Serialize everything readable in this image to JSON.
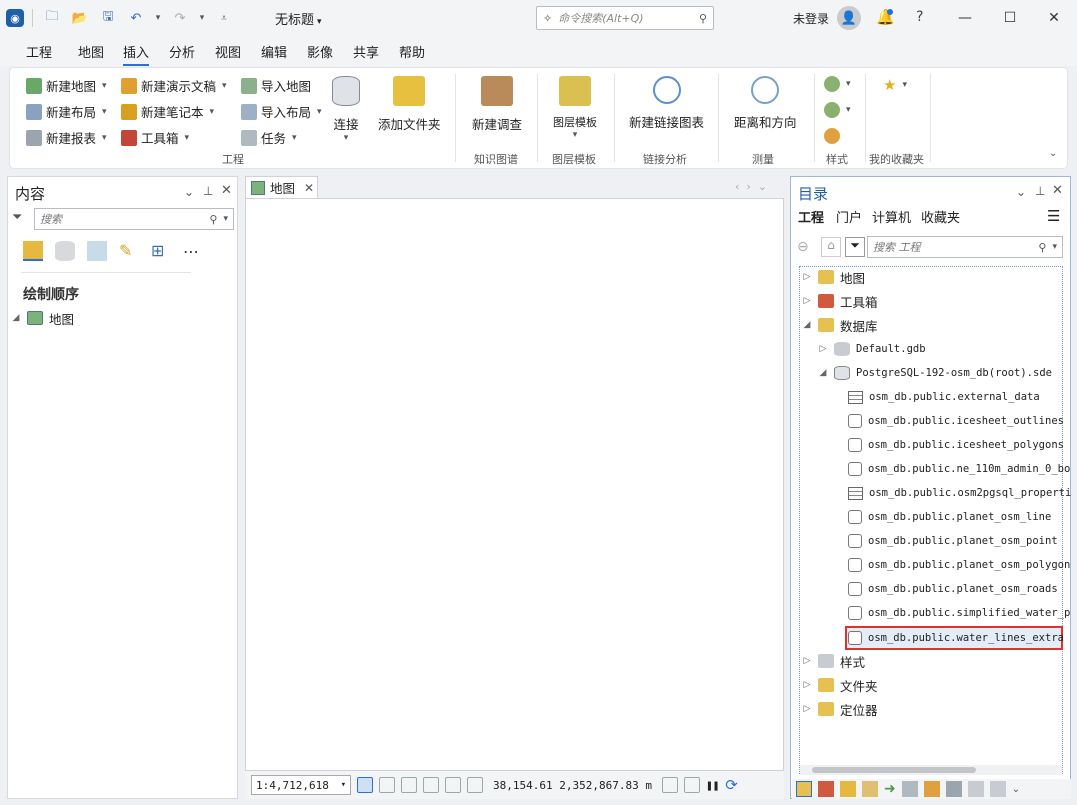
{
  "titlebar": {
    "doc_title": "无标题",
    "command_search_placeholder": "命令搜索(Alt+Q)",
    "login_label": "未登录",
    "help_label": "?",
    "minimize": "—",
    "maximize": "☐",
    "close": "✕"
  },
  "menu": {
    "tabs": [
      "工程",
      "地图",
      "插入",
      "分析",
      "视图",
      "编辑",
      "影像",
      "共享",
      "帮助"
    ],
    "active": "插入"
  },
  "ribbon": {
    "new_map": "新建地图",
    "new_presentation": "新建演示文稿",
    "import_map": "导入地图",
    "new_layout": "新建布局",
    "new_notebook": "新建笔记本",
    "import_layout": "导入布局",
    "new_report": "新建报表",
    "toolbox": "工具箱",
    "task": "任务",
    "connect": "连接",
    "add_folder": "添加文件夹",
    "group_project": "工程",
    "new_survey": "新建调查",
    "group_knowledge": "知识图谱",
    "layer_template": "图层模板",
    "group_layer_template": "图层模板",
    "new_link_chart": "新建链接图表",
    "group_link_analysis": "链接分析",
    "distance_direction": "距离和方向",
    "group_measure": "测量",
    "group_styles": "样式",
    "group_favorites": "我的收藏夹"
  },
  "contents": {
    "title": "内容",
    "search_placeholder": "搜索",
    "section": "绘制顺序",
    "items": [
      {
        "label": "地图"
      }
    ]
  },
  "map": {
    "tab_label": "地图",
    "scale": "1:4,712,618",
    "coordinates": "38,154.61 2,352,867.83 m"
  },
  "catalog": {
    "title": "目录",
    "tabs": [
      "工程",
      "门户",
      "计算机",
      "收藏夹"
    ],
    "search_placeholder": "搜索 工程",
    "tree": [
      {
        "label": "地图",
        "level": 0,
        "state": "collapsed",
        "icon": "map-folder"
      },
      {
        "label": "工具箱",
        "level": 0,
        "state": "collapsed",
        "icon": "toolbox-folder"
      },
      {
        "label": "数据库",
        "level": 0,
        "state": "expanded",
        "icon": "database-folder"
      },
      {
        "label": "Default.gdb",
        "level": 1,
        "state": "collapsed",
        "icon": "geodatabase"
      },
      {
        "label": "PostgreSQL-192-osm_db(root).sde",
        "level": 1,
        "state": "expanded",
        "icon": "enterprise-database"
      },
      {
        "label": "osm_db.public.external_data",
        "level": 2,
        "icon": "table"
      },
      {
        "label": "osm_db.public.icesheet_outlines",
        "level": 2,
        "icon": "feature-class"
      },
      {
        "label": "osm_db.public.icesheet_polygons",
        "level": 2,
        "icon": "feature-class"
      },
      {
        "label": "osm_db.public.ne_110m_admin_0_bo",
        "level": 2,
        "icon": "feature-class"
      },
      {
        "label": "osm_db.public.osm2pgsql_properti",
        "level": 2,
        "icon": "table"
      },
      {
        "label": "osm_db.public.planet_osm_line",
        "level": 2,
        "icon": "feature-class"
      },
      {
        "label": "osm_db.public.planet_osm_point",
        "level": 2,
        "icon": "feature-class"
      },
      {
        "label": "osm_db.public.planet_osm_polygon",
        "level": 2,
        "icon": "feature-class"
      },
      {
        "label": "osm_db.public.planet_osm_roads",
        "level": 2,
        "icon": "feature-class"
      },
      {
        "label": "osm_db.public.simplified_water_p",
        "level": 2,
        "icon": "feature-class"
      },
      {
        "label": "osm_db.public.water_lines_extra",
        "level": 2,
        "icon": "feature-class",
        "selected": true
      },
      {
        "label": "样式",
        "level": 0,
        "state": "collapsed",
        "icon": "styles-folder"
      },
      {
        "label": "文件夹",
        "level": 0,
        "state": "collapsed",
        "icon": "folder"
      },
      {
        "label": "定位器",
        "level": 0,
        "state": "collapsed",
        "icon": "locator-folder"
      }
    ]
  },
  "colors": {
    "accent": "#2a6fdb",
    "selection_border": "#e03030"
  }
}
